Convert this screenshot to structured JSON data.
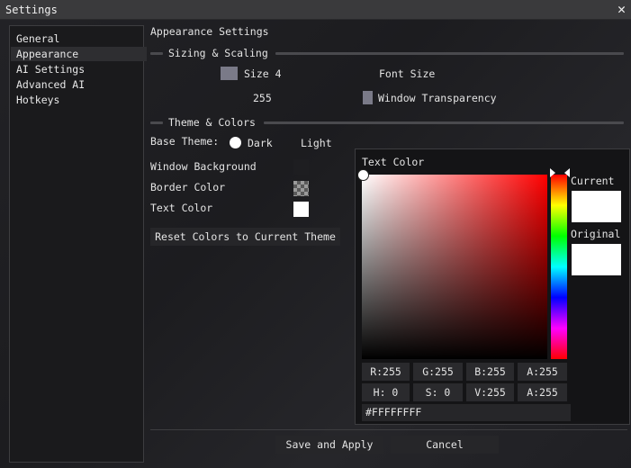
{
  "window": {
    "title": "Settings",
    "close_glyph": "✕"
  },
  "sidebar": {
    "items": [
      {
        "label": "General"
      },
      {
        "label": "Appearance"
      },
      {
        "label": "AI Settings"
      },
      {
        "label": "Advanced AI"
      },
      {
        "label": "Hotkeys"
      }
    ],
    "active": "Appearance"
  },
  "main": {
    "title": "Appearance Settings",
    "sizing": {
      "header": "Sizing & Scaling",
      "font_size_value": "Size 4",
      "font_size_label": "Font Size",
      "transparency_value": "255",
      "transparency_label": "Window Transparency"
    },
    "theme": {
      "header": "Theme & Colors",
      "base_theme_label": "Base Theme:",
      "dark_label": "Dark",
      "light_label": "Light",
      "selected": "Dark",
      "window_bg_label": "Window Background",
      "border_color_label": "Border Color",
      "text_color_label": "Text Color",
      "reset_label": "Reset Colors to Current Theme"
    }
  },
  "colorpicker": {
    "title": "Text Color",
    "current_label": "Current",
    "original_label": "Original",
    "rgba": {
      "r": "R:255",
      "g": "G:255",
      "b": "B:255",
      "a": "A:255"
    },
    "hsva": {
      "h": "H:  0",
      "s": "S:  0",
      "v": "V:255",
      "a": "A:255"
    },
    "hex": "#FFFFFFFF",
    "color": "#FFFFFF"
  },
  "footer": {
    "save_label": "Save and Apply",
    "cancel_label": "Cancel"
  },
  "colors": {
    "background": "#1b1b1e",
    "titlebar": "#3a3a3c",
    "panel": "#1a1a1c",
    "swatch_gray": "#7a7a88"
  }
}
